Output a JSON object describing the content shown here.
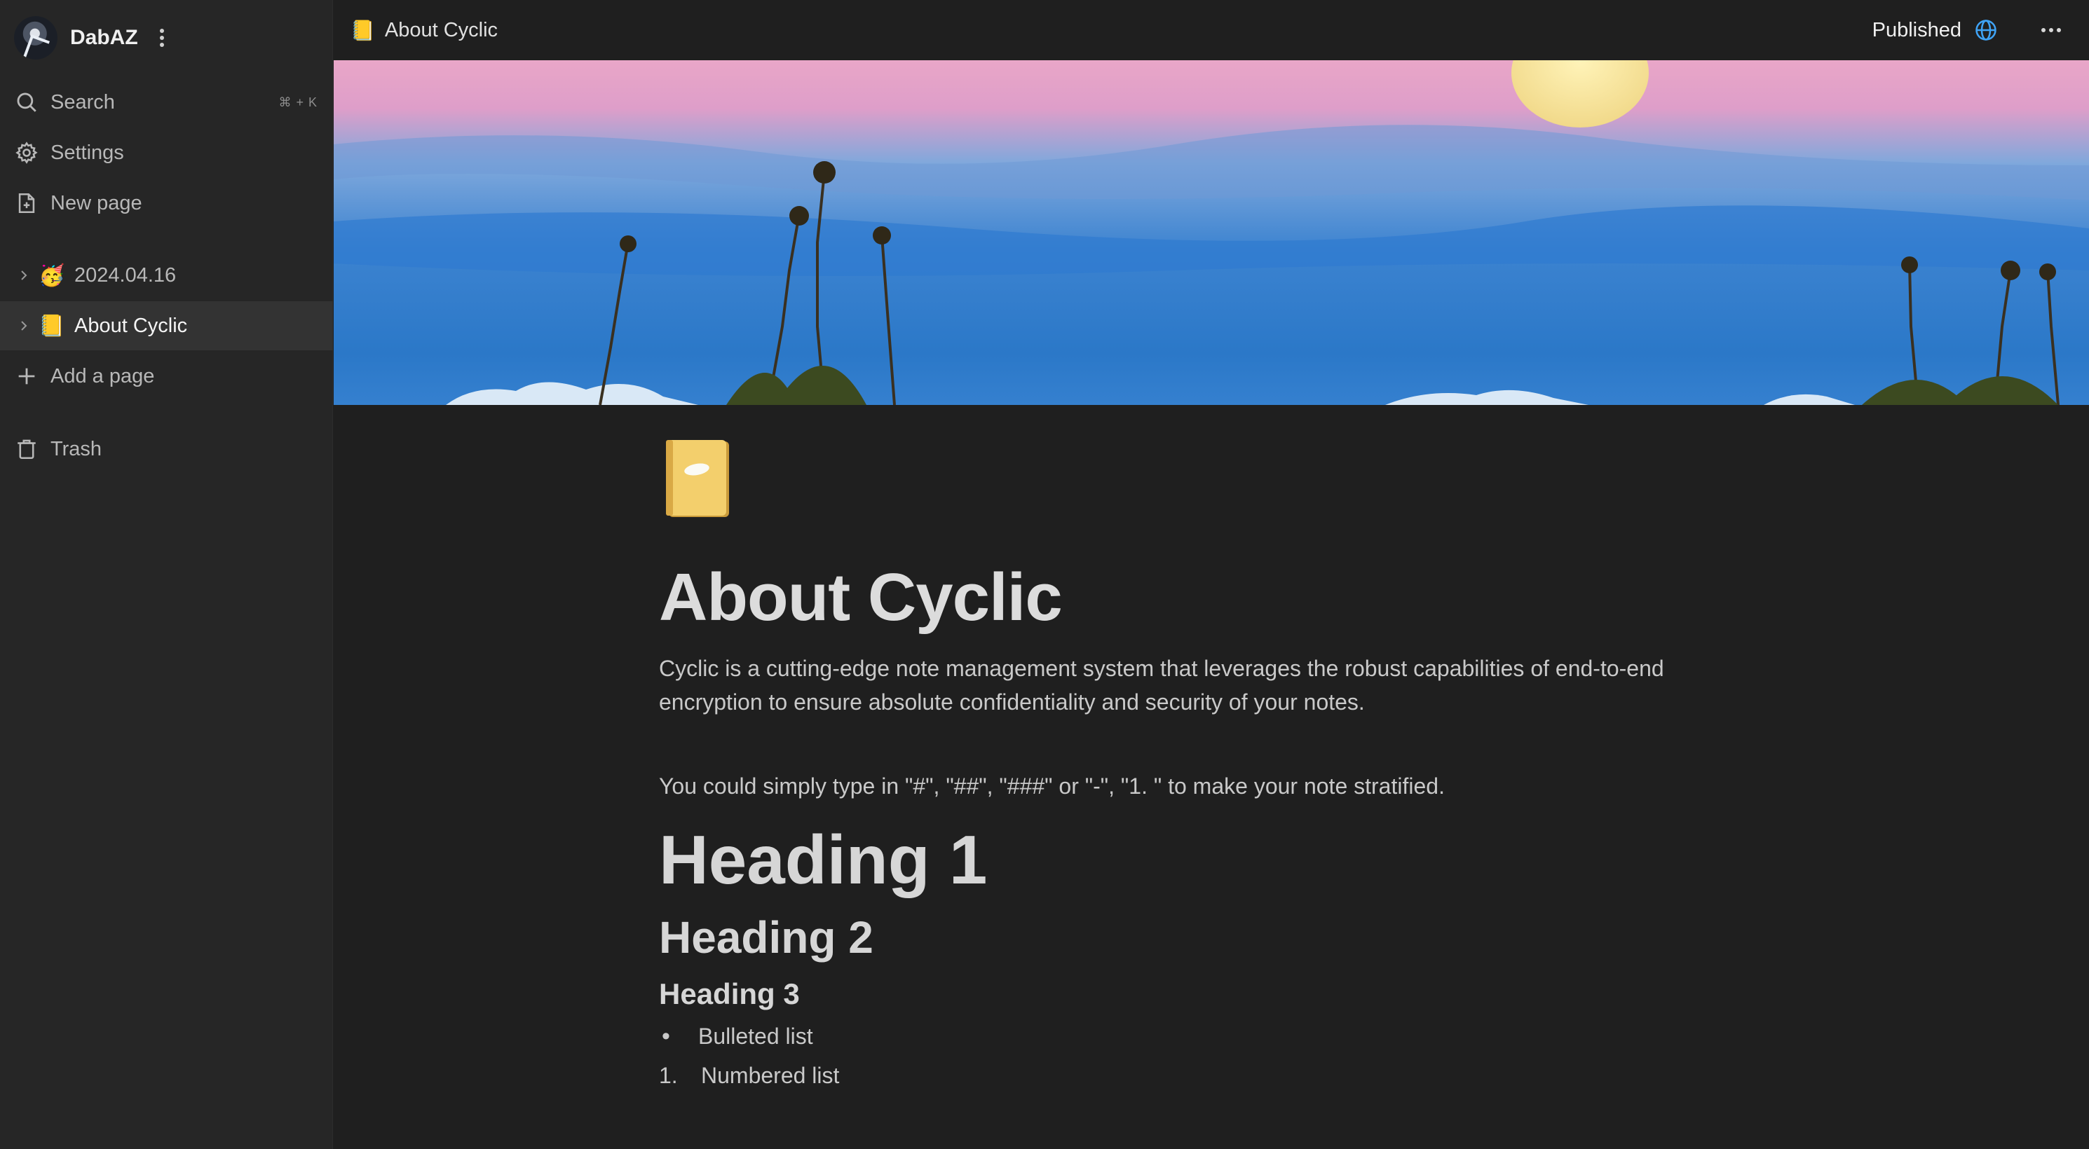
{
  "workspace": {
    "user_name": "DabAZ"
  },
  "sidebar": {
    "search_label": "Search",
    "search_shortcut": "⌘ + K",
    "settings_label": "Settings",
    "new_page_label": "New page",
    "pages": [
      {
        "emoji": "🥳",
        "label": "2024.04.16"
      },
      {
        "emoji": "📒",
        "label": "About Cyclic"
      }
    ],
    "add_page_label": "Add a page",
    "trash_label": "Trash"
  },
  "topbar": {
    "breadcrumb_emoji": "📒",
    "breadcrumb_title": "About Cyclic",
    "published_label": "Published"
  },
  "page": {
    "emoji": "📒",
    "title": "About Cyclic",
    "intro": "Cyclic is a cutting-edge note management system that leverages the robust capabilities of end-to-end encryption to ensure absolute confidentiality and security of your notes.",
    "hint": "You could simply type in \"#\", \"##\", \"###\" or \"-\", \"1. \" to make your note stratified.",
    "heading1": "Heading 1",
    "heading2": "Heading 2",
    "heading3": "Heading 3",
    "bullet_marker": "•",
    "bullet_item": "Bulleted list",
    "number_marker": "1.",
    "numbered_item": "Numbered list"
  },
  "colors": {
    "accent_globe": "#3fa3f5",
    "sidebar_bg": "#262626",
    "main_bg": "#1f1f1f"
  }
}
